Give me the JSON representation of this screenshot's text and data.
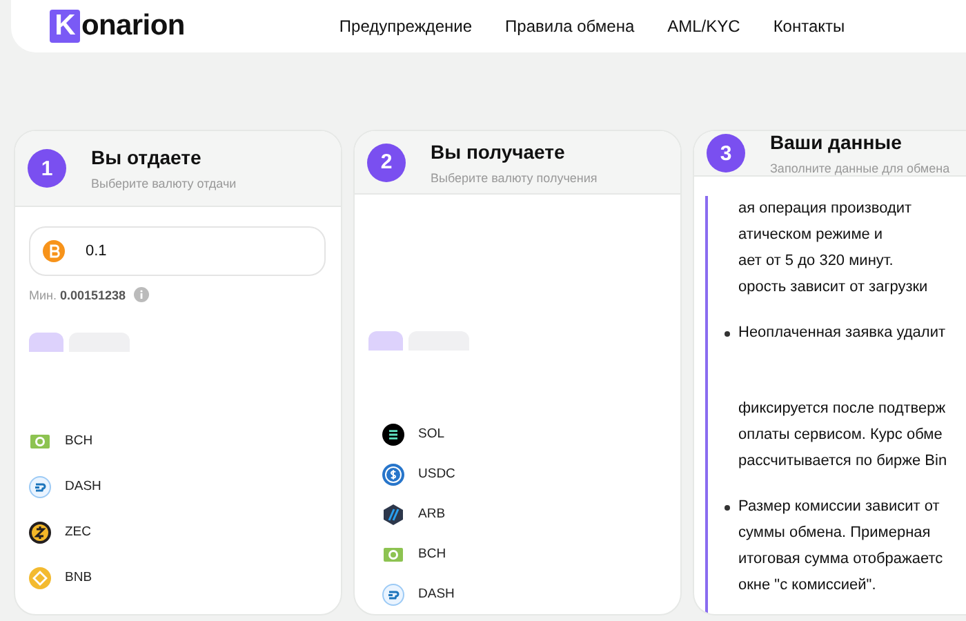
{
  "header": {
    "logo": {
      "letter": "K",
      "rest": "onarion"
    },
    "nav": [
      "Предупреждение",
      "Правила обмена",
      "AML/KYC",
      "Контакты"
    ]
  },
  "steps": [
    {
      "kind": "exchange",
      "number": "1",
      "title": "Вы отдаете",
      "subtitle": "Выберите валюту отдачи",
      "amount": {
        "kind": "btc",
        "value": "0.1"
      },
      "min": {
        "label": "Мин.",
        "value": "0.00151238"
      },
      "chips": [
        {
          "selected": true
        },
        {
          "selected": false
        }
      ],
      "coins": [
        {
          "kind": "bch",
          "name": "BCH"
        },
        {
          "kind": "dash",
          "name": "DASH"
        },
        {
          "kind": "zec",
          "name": "ZEC"
        },
        {
          "kind": "bnb",
          "name": "BNB"
        }
      ]
    },
    {
      "kind": "exchange",
      "number": "2",
      "title": "Вы получаете",
      "subtitle": "Выберите валюту получения",
      "chips": [
        {
          "selected": true
        },
        {
          "selected": false
        }
      ],
      "coins": [
        {
          "kind": "sol",
          "name": "SOL"
        },
        {
          "kind": "usdc",
          "name": "USDC"
        },
        {
          "kind": "arb",
          "name": "ARB"
        },
        {
          "kind": "bch",
          "name": "BCH"
        },
        {
          "kind": "dash",
          "name": "DASH"
        }
      ]
    },
    {
      "kind": "info",
      "number": "3",
      "title": "Ваши данные",
      "subtitle": "Заполните данные для обмена",
      "notes": [
        {
          "bullet": false,
          "lines": [
            "ая операция производит",
            "атическом режиме и",
            "ает от 5 до 320 минут.",
            "орость зависит от загрузки"
          ]
        },
        {
          "bullet": true,
          "lines": [
            "Неоплаченная заявка удалит"
          ]
        },
        {
          "bullet": false,
          "lines": [
            "фиксируется после подтверж",
            "оплаты сервисом. Курс обме",
            "рассчитывается по бирже Bin"
          ]
        },
        {
          "bullet": true,
          "lines": [
            "Размер комиссии зависит от",
            "суммы обмена. Примерная",
            "итоговая сумма отображаетс",
            "окне \"с комиссией\"."
          ]
        }
      ]
    }
  ]
}
